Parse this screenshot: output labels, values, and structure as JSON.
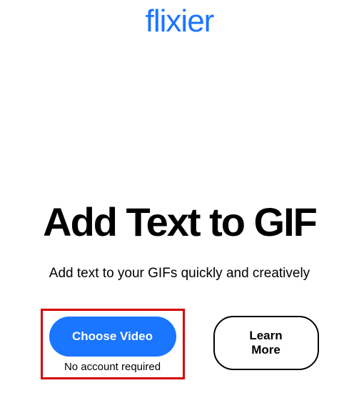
{
  "logo": {
    "text": "flixier"
  },
  "hero": {
    "title": "Add Text to GIF",
    "subtitle": "Add text to your GIFs quickly and creatively"
  },
  "actions": {
    "primary_label": "Choose Video",
    "primary_caption": "No account required",
    "secondary_label": "Learn More"
  }
}
